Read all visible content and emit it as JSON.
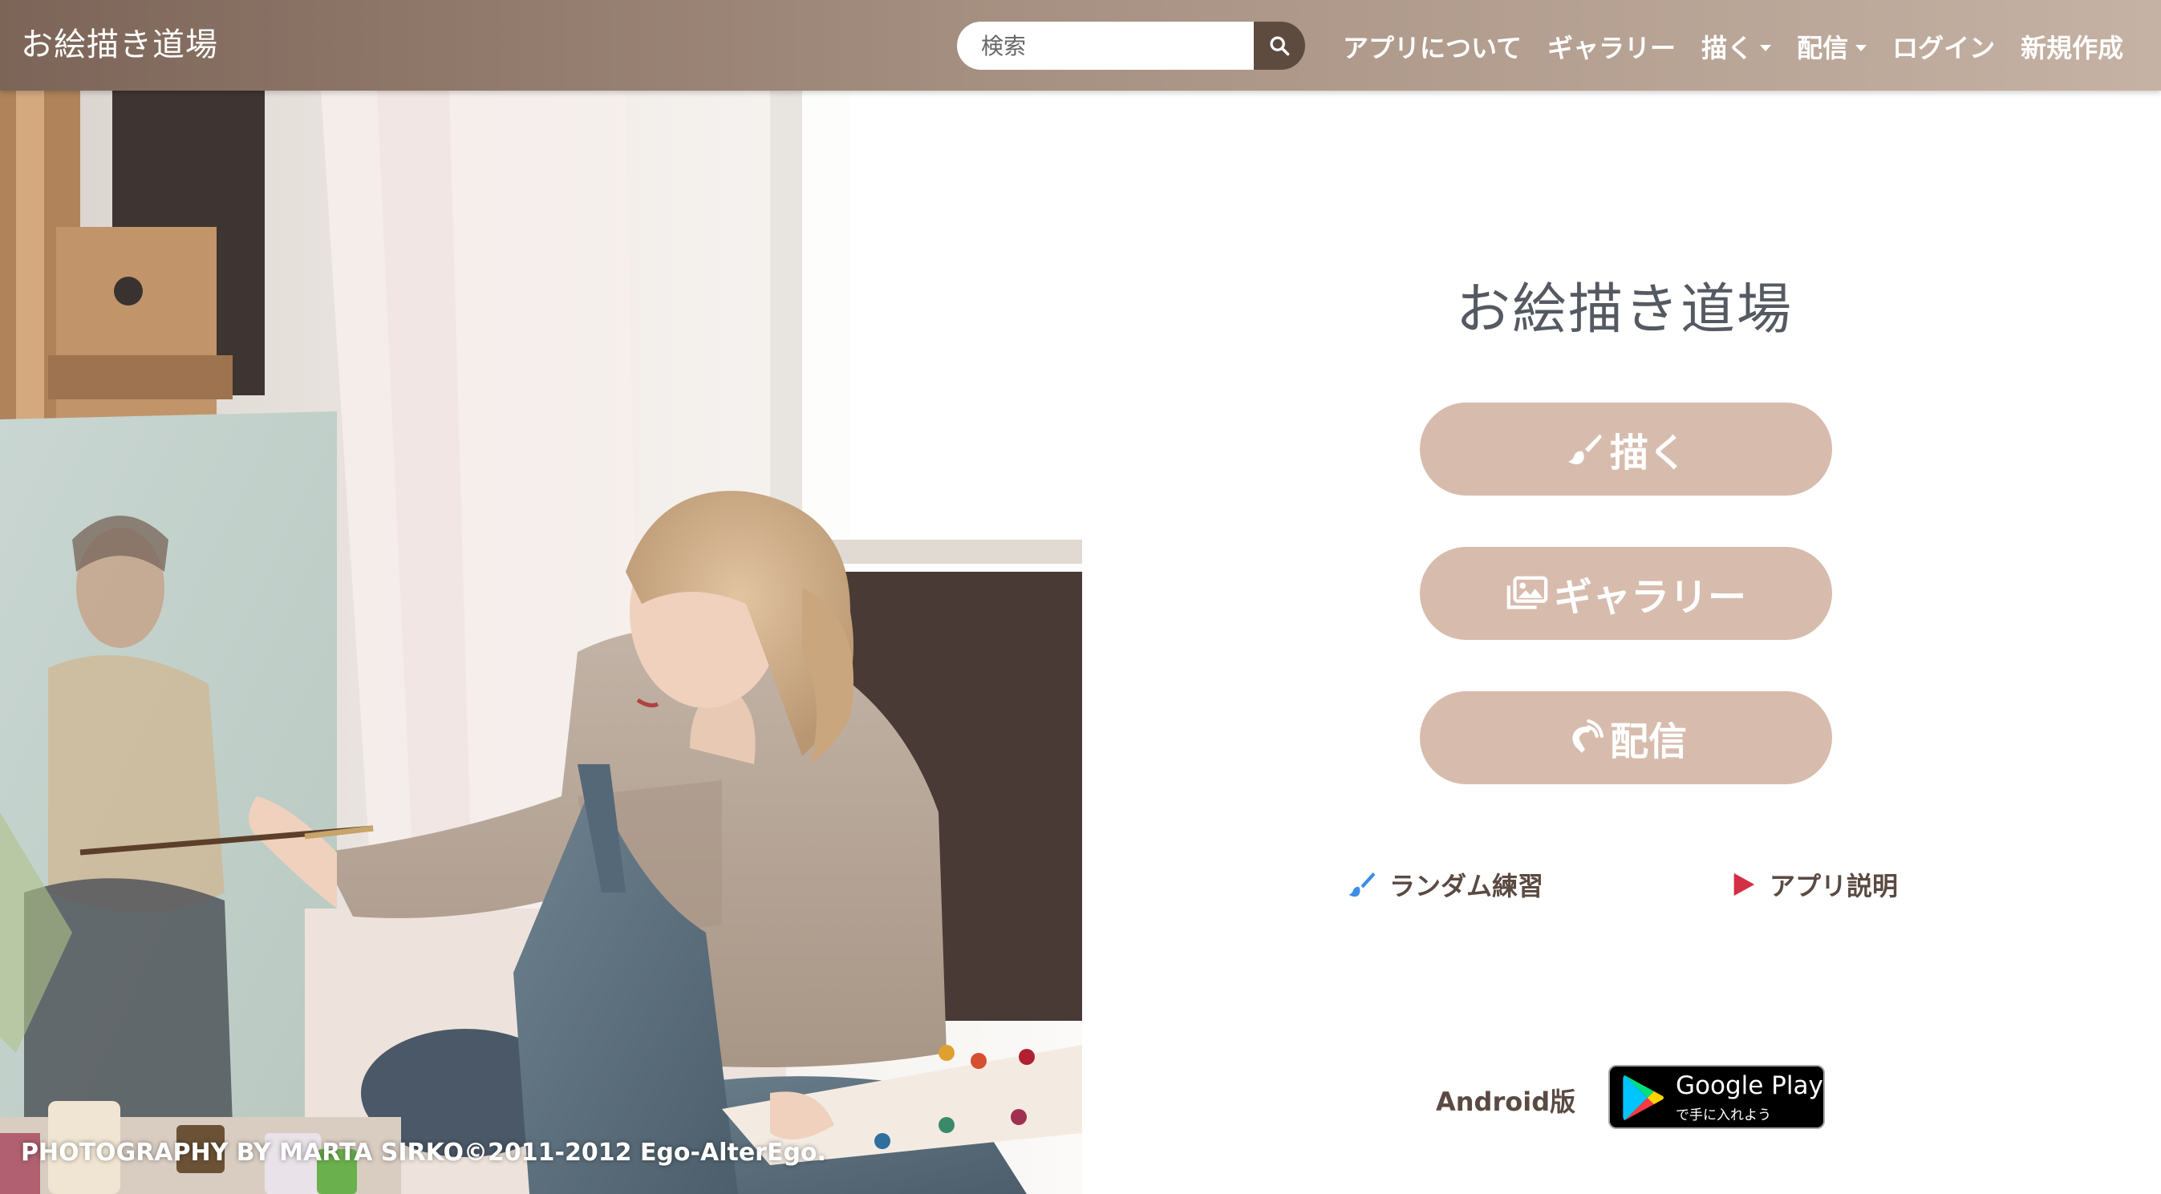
{
  "navbar": {
    "brand": "お絵描き道場",
    "search": {
      "placeholder": "検索"
    },
    "items": [
      {
        "label": "アプリについて"
      },
      {
        "label": "ギャラリー"
      },
      {
        "label": "描く"
      },
      {
        "label": "配信"
      },
      {
        "label": "ログイン"
      },
      {
        "label": "新規作成"
      }
    ]
  },
  "hero": {
    "credit": "PHOTOGRAPHY BY MARTA SIRKO©2011-2012 Ego-AlterEgo."
  },
  "main": {
    "title": "お絵描き道場",
    "buttons": [
      {
        "label": "描く",
        "icon": "paintbrush-icon"
      },
      {
        "label": "ギャラリー",
        "icon": "images-icon"
      },
      {
        "label": "配信",
        "icon": "broadcast-icon"
      }
    ],
    "links": [
      {
        "label": "ランダム練習",
        "icon": "brush-icon"
      },
      {
        "label": "アプリ説明",
        "icon": "play-icon"
      }
    ],
    "android": {
      "label": "Android版",
      "badge_title": "Google Play",
      "badge_sub": "で手に入れよう"
    }
  },
  "colors": {
    "navbar": "#8a7265",
    "button": "#d7bcad",
    "text": "#5a4a42",
    "play_red": "#d32f45",
    "brush_blue": "#3a8ee6"
  }
}
